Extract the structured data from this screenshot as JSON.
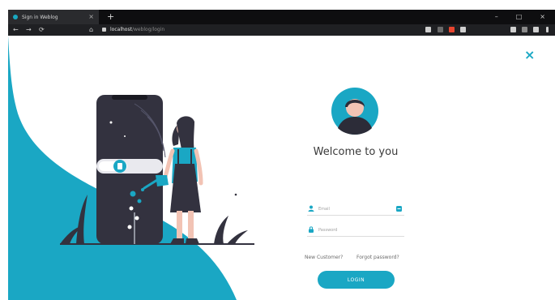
{
  "browser": {
    "tab_title": "Sign in Weblog",
    "tab_close": "×",
    "new_tab": "+",
    "url_host": "localhost",
    "url_path": "/weblog/login",
    "controls": {
      "minimize": "–",
      "maximize": "□",
      "close": "×"
    },
    "nav": {
      "back": "←",
      "forward": "→",
      "reload": "⟳",
      "home": "⌂"
    }
  },
  "modal": {
    "close": "×"
  },
  "login": {
    "title": "Welcome to you",
    "email_placeholder": "Email",
    "password_placeholder": "Password",
    "new_customer": "New Customer?",
    "forgot_password": "Forgot password?",
    "login_button": "LOGIN"
  },
  "colors": {
    "accent": "#1aa7c4",
    "dark": "#33323f",
    "text": "#3a3a3a",
    "chrome_dark": "#0e0e10"
  },
  "icons": {
    "email": "user-icon",
    "password": "lock-icon",
    "email_badge": "key-icon",
    "close": "close-icon"
  }
}
